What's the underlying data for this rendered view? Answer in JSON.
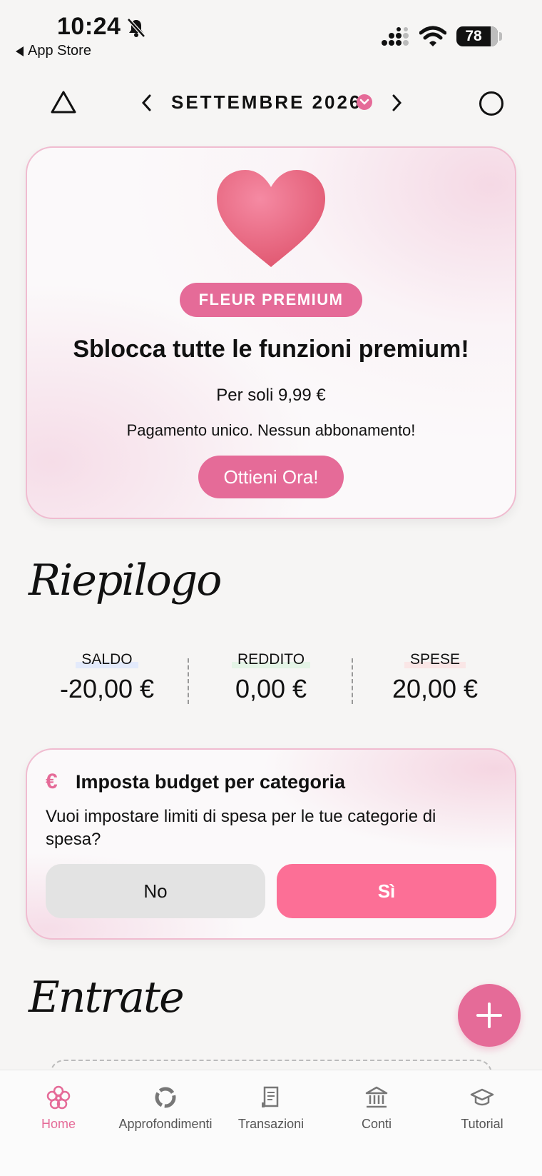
{
  "status_bar": {
    "time": "10:24",
    "back_label": "App Store",
    "battery": "78"
  },
  "header": {
    "month": "SETTEMBRE 2026"
  },
  "premium": {
    "badge": "FLEUR PREMIUM",
    "title": "Sblocca tutte le funzioni premium!",
    "price": "Per soli 9,99 €",
    "subtitle": "Pagamento unico. Nessun abbonamento!",
    "cta": "Ottieni Ora!"
  },
  "summary": {
    "title": "Riepilogo",
    "items": [
      {
        "label": "SALDO",
        "value": "-20,00 €"
      },
      {
        "label": "REDDITO",
        "value": "0,00 €"
      },
      {
        "label": "SPESE",
        "value": "20,00 €"
      }
    ]
  },
  "budget": {
    "icon": "€",
    "title": "Imposta budget per categoria",
    "text": "Vuoi impostare limiti di spesa per le tue categorie di spesa?",
    "no": "No",
    "yes": "Sì"
  },
  "income": {
    "title": "Entrate"
  },
  "tabs": [
    {
      "label": "Home",
      "icon": "flower-icon",
      "active": true
    },
    {
      "label": "Approfondimenti",
      "icon": "donut-chart-icon"
    },
    {
      "label": "Transazioni",
      "icon": "receipt-icon"
    },
    {
      "label": "Conti",
      "icon": "bank-icon"
    },
    {
      "label": "Tutorial",
      "icon": "graduation-cap-icon"
    }
  ],
  "colors": {
    "accent": "#e56b98",
    "yes_button": "#fc6f96",
    "card_border": "#f0bcd0"
  }
}
